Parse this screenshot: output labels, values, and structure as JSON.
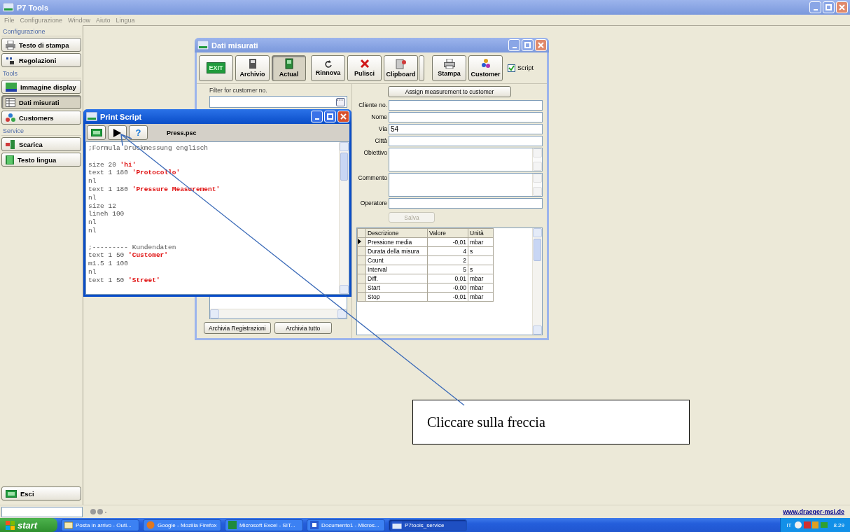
{
  "app": {
    "title": "P7 Tools",
    "active": false,
    "menu": [
      "File",
      "Configurazione",
      "Window",
      "Aiuto",
      "Lingua"
    ]
  },
  "sidebar": {
    "groups": [
      {
        "title": "Configurazione",
        "items": [
          {
            "label": "Testo di stampa",
            "kind": "printer",
            "selected": false
          },
          {
            "label": "Regolazioni",
            "kind": "settings",
            "selected": false
          }
        ]
      },
      {
        "title": "Tools",
        "items": [
          {
            "label": "Immagine display",
            "kind": "display",
            "selected": false
          },
          {
            "label": "Dati misurati",
            "kind": "table",
            "selected": true
          },
          {
            "label": "Customers",
            "kind": "people",
            "selected": false
          }
        ]
      },
      {
        "title": "Service",
        "items": [
          {
            "label": "Scarica",
            "kind": "download",
            "selected": false
          },
          {
            "label": "Testo lingua",
            "kind": "book",
            "selected": false
          }
        ]
      }
    ],
    "exit_button": "Esci"
  },
  "dati_window": {
    "title": "Dati misurati",
    "active": false,
    "toolbar": [
      {
        "kind": "exit",
        "label": "EXIT",
        "selected": false
      },
      {
        "kind": "archive",
        "label": "Archivio",
        "selected": false
      },
      {
        "kind": "actual",
        "label": "Actual",
        "selected": true
      },
      {
        "kind": "refresh",
        "label": "Rinnova",
        "selected": false
      },
      {
        "kind": "clear",
        "label": "Pulisci",
        "selected": false
      },
      {
        "kind": "clipboard",
        "label": "Clipboard",
        "selected": false
      },
      {
        "kind": "spacer",
        "selected": false
      },
      {
        "kind": "print",
        "label": "Stampa",
        "selected": false
      },
      {
        "kind": "customer",
        "label": "Customer",
        "selected": false
      }
    ],
    "script_checkbox": {
      "label": "Script",
      "checked": true
    },
    "filter": {
      "label": "Filter for customer no."
    },
    "archive_buttons": [
      "Archivia Registrazioni",
      "Archivia tutto"
    ],
    "assign_button": "Assign measurement to customer",
    "fields": [
      {
        "label": "Cliente no.",
        "kind": "line"
      },
      {
        "label": "Nome",
        "kind": "line"
      },
      {
        "label": "Via",
        "kind": "line",
        "value": "54"
      },
      {
        "label": "Città",
        "kind": "line"
      },
      {
        "label": "Obiettivo",
        "kind": "memo"
      },
      {
        "label": "Commento",
        "kind": "memo"
      },
      {
        "label": "Operatore",
        "kind": "line"
      }
    ],
    "save_button": {
      "label": "Salva",
      "disabled": true
    },
    "table": {
      "columns": [
        "Descrizione",
        "Valore",
        "Unità"
      ],
      "rows": [
        {
          "description": "Pressione media",
          "value": "-0,01",
          "unit": "mbar",
          "selected": true
        },
        {
          "description": "Durata della misura",
          "value": "4",
          "unit": "s",
          "selected": false
        },
        {
          "description": "Count",
          "value": "2",
          "selected": false
        },
        {
          "description": "Interval",
          "value": "5",
          "unit": "s",
          "selected": false
        },
        {
          "description": "Diff.",
          "value": "0,01",
          "unit": "mbar",
          "selected": false
        },
        {
          "description": "Start",
          "value": "-0,00",
          "unit": "mbar",
          "selected": false
        },
        {
          "description": "Stop",
          "value": "-0,01",
          "unit": "mbar",
          "selected": false
        }
      ]
    }
  },
  "script_window": {
    "title": "Print Script",
    "active": true,
    "toolbar": [
      {
        "kind": "exit"
      },
      {
        "kind": "run"
      },
      {
        "kind": "help",
        "label": "?"
      }
    ],
    "file": "Press.psc",
    "lines": [
      {
        "text": ";Formula Druckmessung englisch",
        "blank_before": false
      },
      {
        "text": "size 20 **'hi'**",
        "blank_before": true
      },
      {
        "text": "text 1 180 **'Protocollo'**",
        "blank_before": false
      },
      {
        "text": "nl",
        "blank_before": false
      },
      {
        "text": "text 1 180 **'Pressure Measurement'**",
        "blank_before": false
      },
      {
        "text": "nl",
        "blank_before": false
      },
      {
        "text": "size 12",
        "blank_before": false
      },
      {
        "text": "lineh 100",
        "blank_before": false
      },
      {
        "text": "nl",
        "blank_before": false
      },
      {
        "text": "nl",
        "blank_before": false
      },
      {
        "text": ";--------- Kundendaten",
        "blank_before": true
      },
      {
        "text": "text 1 50 **'Customer'**",
        "blank_before": false
      },
      {
        "text": "m1.5 1 100",
        "blank_before": false
      },
      {
        "text": "nl",
        "blank_before": false
      },
      {
        "text": "text 1 50 **'Street'**",
        "blank_before": false
      }
    ]
  },
  "callout": {
    "text": "Cliccare sulla freccia"
  },
  "status_bar": {
    "link": "www.draeger-msi.de"
  },
  "taskbar": {
    "start": "start",
    "items": [
      {
        "label": "Posta in arrivo - Outl...",
        "kind": "mail",
        "selected": false
      },
      {
        "label": "Google - Mozilla Firefox",
        "kind": "browser",
        "selected": false
      },
      {
        "label": "Microsoft Excel - SIT...",
        "kind": "sheet",
        "selected": false
      },
      {
        "label": "Documento1 - Micros...",
        "kind": "doc",
        "selected": false
      },
      {
        "label": "P7tools_service",
        "kind": "app",
        "selected": true
      }
    ],
    "language": "IT",
    "clock": "8.29"
  }
}
